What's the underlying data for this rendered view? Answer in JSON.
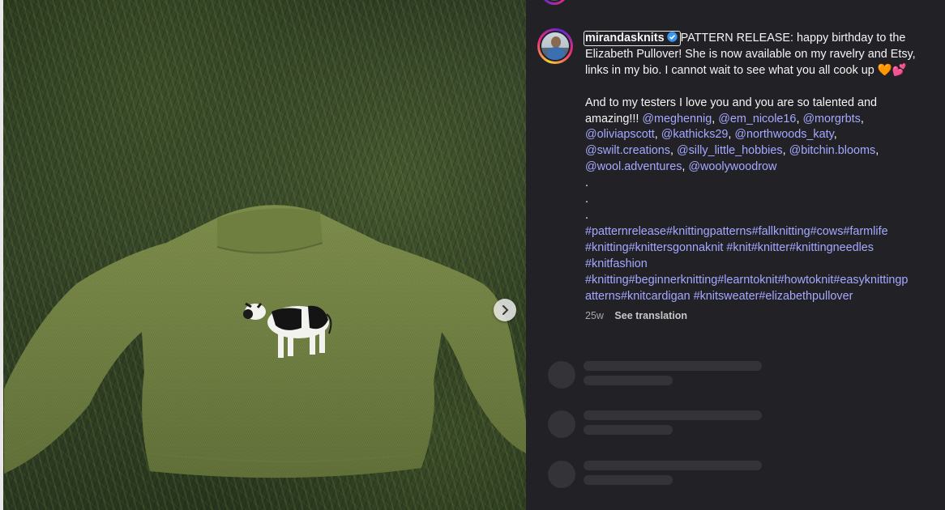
{
  "post": {
    "username": "mirandasknits",
    "caption_lines": [
      "PATTERN RELEASE: happy birthday to the",
      "Elizabeth Pullover! She is now available on my ravelry and Etsy,",
      "links in my bio. I cannot wait to see what you all cook up",
      "And to my testers I love you and you are so talented and",
      "amazing!!!"
    ],
    "emoji": "🧡💕",
    "mentions": [
      "@meghennig",
      "@em_nicole16",
      "@morgrbts",
      "@oliviapscott",
      "@kathicks29",
      "@northwoods_katy",
      "@swilt.creations",
      "@silly_little_hobbies",
      "@bitchin.blooms",
      "@wool.adventures",
      "@woolywoodrow"
    ],
    "dots": [
      ".",
      ".",
      "."
    ],
    "hashtag_lines": [
      "#patternrelease#knittingpatterns#fallknitting#cows#farmlife",
      "#knitting#knittersgonnaknit #knit#knitter#knittingneedles",
      "#knitfashion",
      "#knitting#beginnerknitting#learntoknit#howtoknit#easyknittingp",
      "atterns#knitcardigan #knitsweater#elizabethpullover"
    ],
    "age": "25w",
    "see_translation": "See translation"
  },
  "colors": {
    "panel_bg": "#212126",
    "link": "#a5a9ff",
    "verified": "#3897f0"
  },
  "icons": {
    "next": "chevron-right-icon",
    "verified": "verified-badge-icon"
  }
}
